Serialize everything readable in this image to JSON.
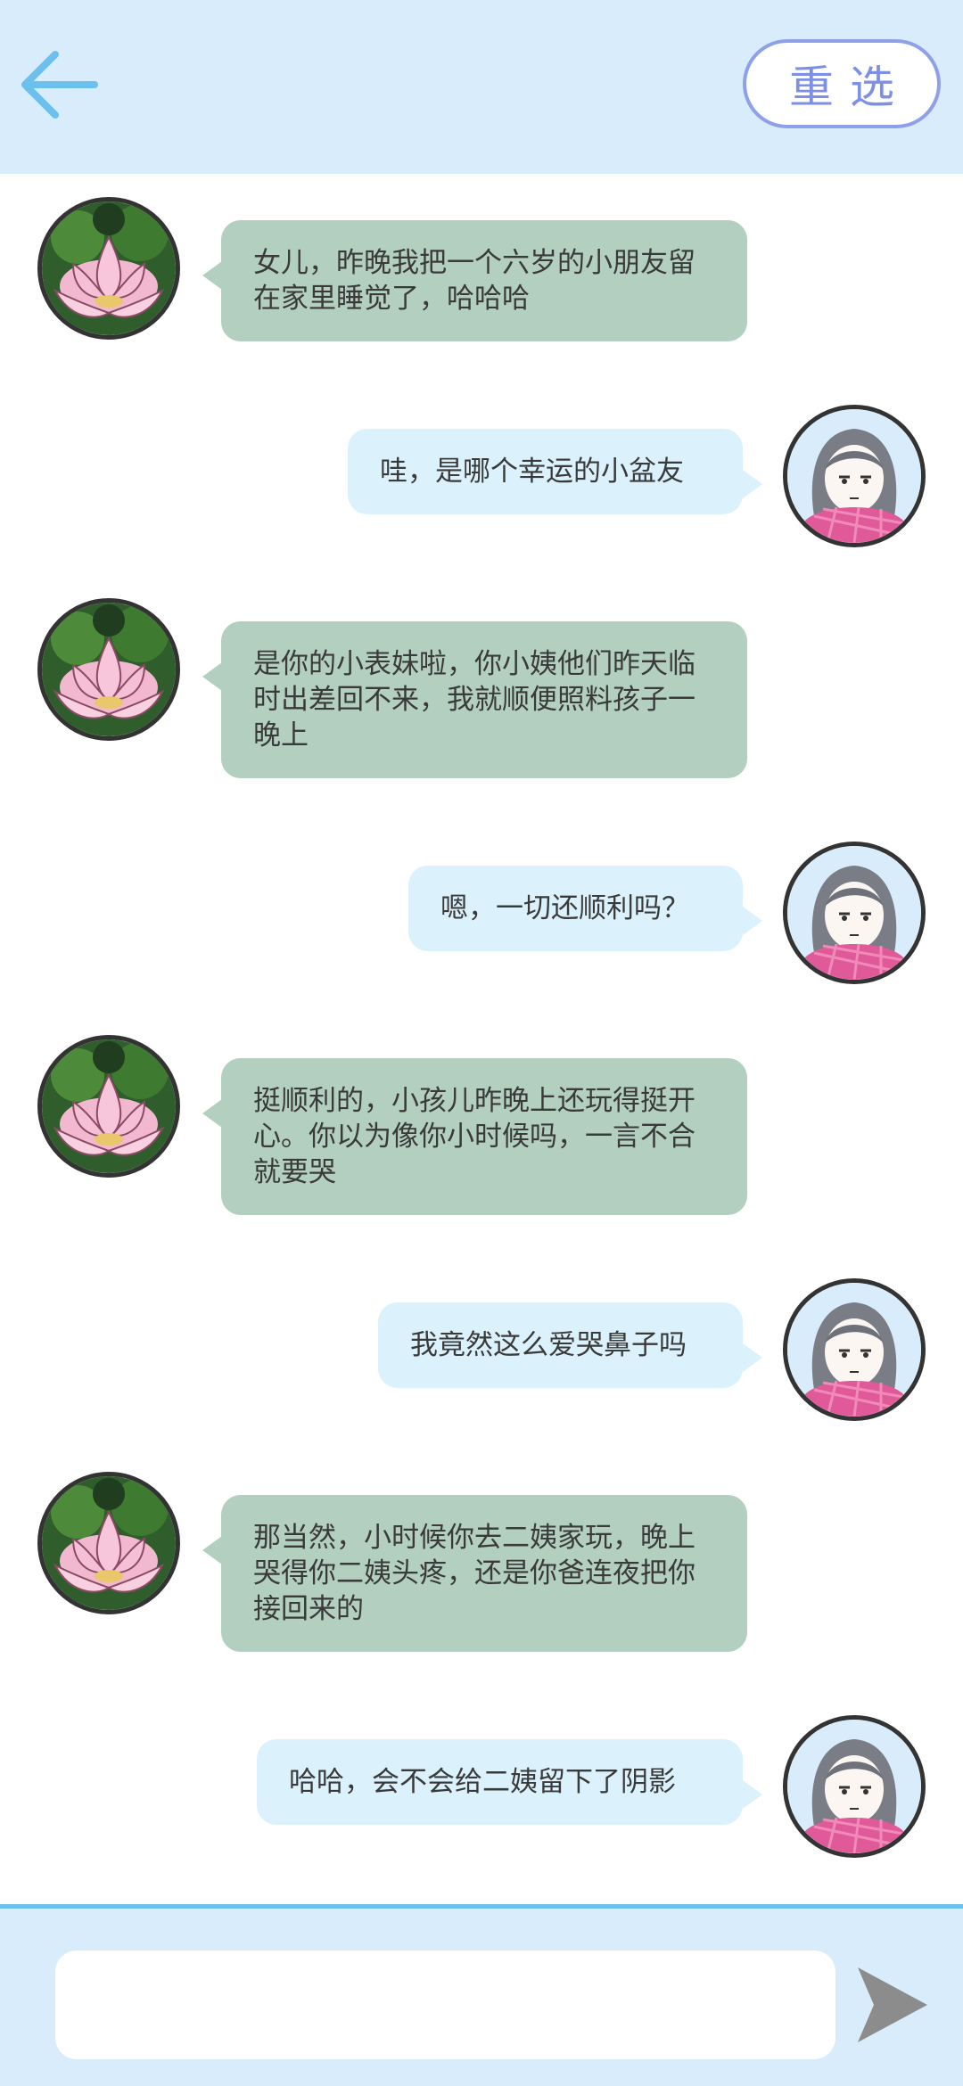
{
  "header": {
    "back_icon": "arrow-left-icon",
    "reselect_label": "重选",
    "accent_color": "#6cc0ee",
    "button_color": "#8ea0ea"
  },
  "messages": [
    {
      "side": "left",
      "sender": "mom",
      "text": "女儿，昨晚我把一个六岁的小朋友留在家里睡觉了，哈哈哈"
    },
    {
      "side": "right",
      "sender": "me",
      "text": "哇，是哪个幸运的小盆友"
    },
    {
      "side": "left",
      "sender": "mom",
      "text": "是你的小表妹啦，你小姨他们昨天临时出差回不来，我就顺便照料孩子一晚上"
    },
    {
      "side": "right",
      "sender": "me",
      "text": "嗯，一切还顺利吗？"
    },
    {
      "side": "left",
      "sender": "mom",
      "text": "挺顺利的，小孩儿昨晚上还玩得挺开心。你以为像你小时候吗，一言不合就要哭"
    },
    {
      "side": "right",
      "sender": "me",
      "text": "我竟然这么爱哭鼻子吗"
    },
    {
      "side": "left",
      "sender": "mom",
      "text": "那当然，小时候你去二姨家玩，晚上哭得你二姨头疼，还是你爸连夜把你接回来的"
    },
    {
      "side": "right",
      "sender": "me",
      "text": "哈哈，会不会给二姨留下了阴影"
    }
  ],
  "colors": {
    "left_bubble": "#b3cfc0",
    "right_bubble": "#dbf1fc",
    "header_bg": "#d8ecfb",
    "send_icon": "#8c8c8c"
  },
  "composer": {
    "placeholder": "",
    "send_icon": "send-arrow-icon"
  }
}
